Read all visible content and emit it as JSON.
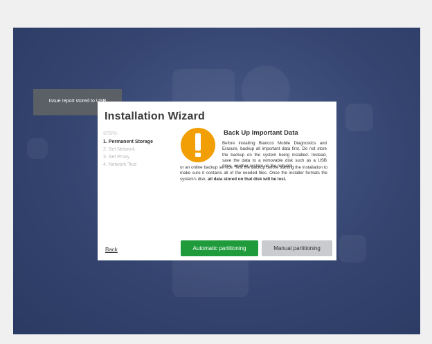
{
  "notification": {
    "text": "Issue report stored to USB"
  },
  "wizard": {
    "title": "Installation Wizard",
    "steps_heading": "STEPS:",
    "steps": [
      "1. Permanent Storage",
      "2. Set Network",
      "3. Set Proxy",
      "4. Network Test"
    ],
    "active_step_index": 0
  },
  "content": {
    "icon": "warning-exclamation-icon",
    "heading": "Back Up Important Data",
    "paragraph_top": "Before installing Blancco Mobile Diagnostics and Erasure, backup all important data first. Do not store the backup on the system being installed. Instead, save the data to a removable disk such as a USB drive, another system on the network,",
    "paragraph_bottom": "or an online backup service. Test the backup before starting the installation to make sure it contains all of the needed files. Once the installer formats the system's disk,",
    "paragraph_bold": "all data stored on that disk will be lost."
  },
  "buttons": {
    "back": "Back",
    "automatic": "Automatic partitioning",
    "manual": "Manual partitioning"
  },
  "colors": {
    "background": "#34446f",
    "warning": "#f29f05",
    "primary_button": "#1f9b3b",
    "secondary_button": "#c9cbce",
    "toast": "#5b5f66"
  }
}
